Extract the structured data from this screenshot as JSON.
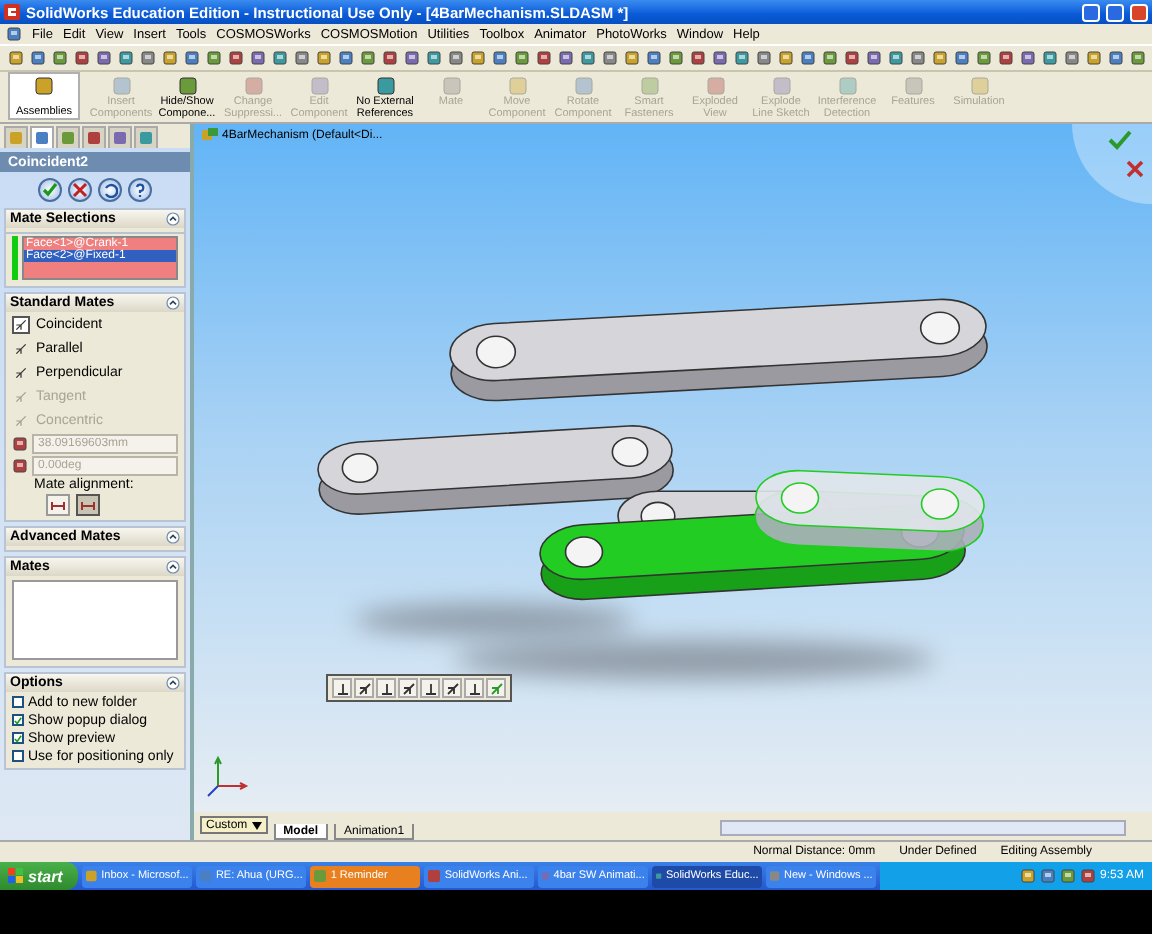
{
  "window": {
    "title": "SolidWorks Education Edition - Instructional Use Only - [4BarMechanism.SLDASM *]"
  },
  "menu": [
    "File",
    "Edit",
    "View",
    "Insert",
    "Tools",
    "COSMOSWorks",
    "COSMOSMotion",
    "Utilities",
    "Toolbox",
    "Animator",
    "PhotoWorks",
    "Window",
    "Help"
  ],
  "command_manager": {
    "buttons": [
      {
        "label": "Assemblies",
        "kind": "menu",
        "disabled": false
      },
      {
        "label": "Insert Components",
        "kind": "tool",
        "disabled": true
      },
      {
        "label": "Hide/Show Compone...",
        "kind": "tool",
        "disabled": false
      },
      {
        "label": "Change Suppressi...",
        "kind": "tool",
        "disabled": true
      },
      {
        "label": "Edit Component",
        "kind": "tool",
        "disabled": true
      },
      {
        "label": "No External References",
        "kind": "tool",
        "disabled": false
      },
      {
        "label": "Mate",
        "kind": "tool",
        "disabled": true
      },
      {
        "label": "Move Component",
        "kind": "tool",
        "disabled": true
      },
      {
        "label": "Rotate Component",
        "kind": "tool",
        "disabled": true
      },
      {
        "label": "Smart Fasteners",
        "kind": "tool",
        "disabled": true
      },
      {
        "label": "Exploded View",
        "kind": "tool",
        "disabled": true
      },
      {
        "label": "Explode Line Sketch",
        "kind": "tool",
        "disabled": true
      },
      {
        "label": "Interference Detection",
        "kind": "tool",
        "disabled": true
      },
      {
        "label": "Features",
        "kind": "tool",
        "disabled": true
      },
      {
        "label": "Simulation",
        "kind": "tool",
        "disabled": true
      }
    ]
  },
  "property_manager": {
    "tabs": [
      {
        "selected": false
      },
      {
        "selected": true
      },
      {
        "selected": false
      },
      {
        "selected": false
      },
      {
        "selected": false
      },
      {
        "selected": false
      }
    ],
    "title": "Coincident2",
    "mate_selections": {
      "title": "Mate Selections",
      "items": [
        {
          "label": "Face<1>@Crank-1",
          "selected": false
        },
        {
          "label": "Face<2>@Fixed-1",
          "selected": true
        }
      ]
    },
    "standard_mates": {
      "title": "Standard Mates",
      "items": [
        {
          "label": "Coincident",
          "selected": true,
          "disabled": false
        },
        {
          "label": "Parallel",
          "selected": false,
          "disabled": false
        },
        {
          "label": "Perpendicular",
          "selected": false,
          "disabled": false
        },
        {
          "label": "Tangent",
          "selected": false,
          "disabled": true
        },
        {
          "label": "Concentric",
          "selected": false,
          "disabled": true
        }
      ],
      "distance": "38.09169603mm",
      "angle": "0.00deg",
      "alignment_label": "Mate alignment:",
      "alignment": [
        {
          "selected": false
        },
        {
          "selected": true
        }
      ]
    },
    "advanced_mates": {
      "title": "Advanced Mates"
    },
    "mates": {
      "title": "Mates"
    },
    "options": {
      "title": "Options",
      "items": [
        {
          "label": "Add to new folder",
          "checked": false
        },
        {
          "label": "Show popup dialog",
          "checked": true
        },
        {
          "label": "Show preview",
          "checked": true
        },
        {
          "label": "Use for positioning only",
          "checked": false
        }
      ]
    }
  },
  "viewport": {
    "tree_label": "4BarMechanism  (Default<Di...",
    "parts": [
      {
        "kind": "solid",
        "selected": false
      },
      {
        "kind": "solid",
        "selected": false
      },
      {
        "kind": "solid",
        "selected": false
      },
      {
        "kind": "solid",
        "selected": true
      },
      {
        "kind": "preview",
        "selected": false
      }
    ]
  },
  "bottom": {
    "view_combo": "Custom",
    "tabs": [
      {
        "label": "Model",
        "selected": true
      },
      {
        "label": "Animation1",
        "selected": false
      }
    ]
  },
  "status_bar": [
    "Normal Distance: 0mm",
    "Under Defined",
    "Editing Assembly"
  ],
  "taskbar": {
    "start": "start",
    "items": [
      {
        "label": "Inbox - Microsof...",
        "kind": "window",
        "selected": false
      },
      {
        "label": "RE: Ahua (URG...",
        "kind": "window",
        "selected": false
      },
      {
        "label": "1 Reminder",
        "kind": "alert",
        "selected": false
      },
      {
        "label": "SolidWorks Ani...",
        "kind": "window",
        "selected": false
      },
      {
        "label": "4bar SW Animati...",
        "kind": "window",
        "selected": false
      },
      {
        "label": "SolidWorks Educ...",
        "kind": "window",
        "selected": true
      },
      {
        "label": "New - Windows ...",
        "kind": "window",
        "selected": false
      }
    ],
    "clock": "9:53 AM"
  }
}
